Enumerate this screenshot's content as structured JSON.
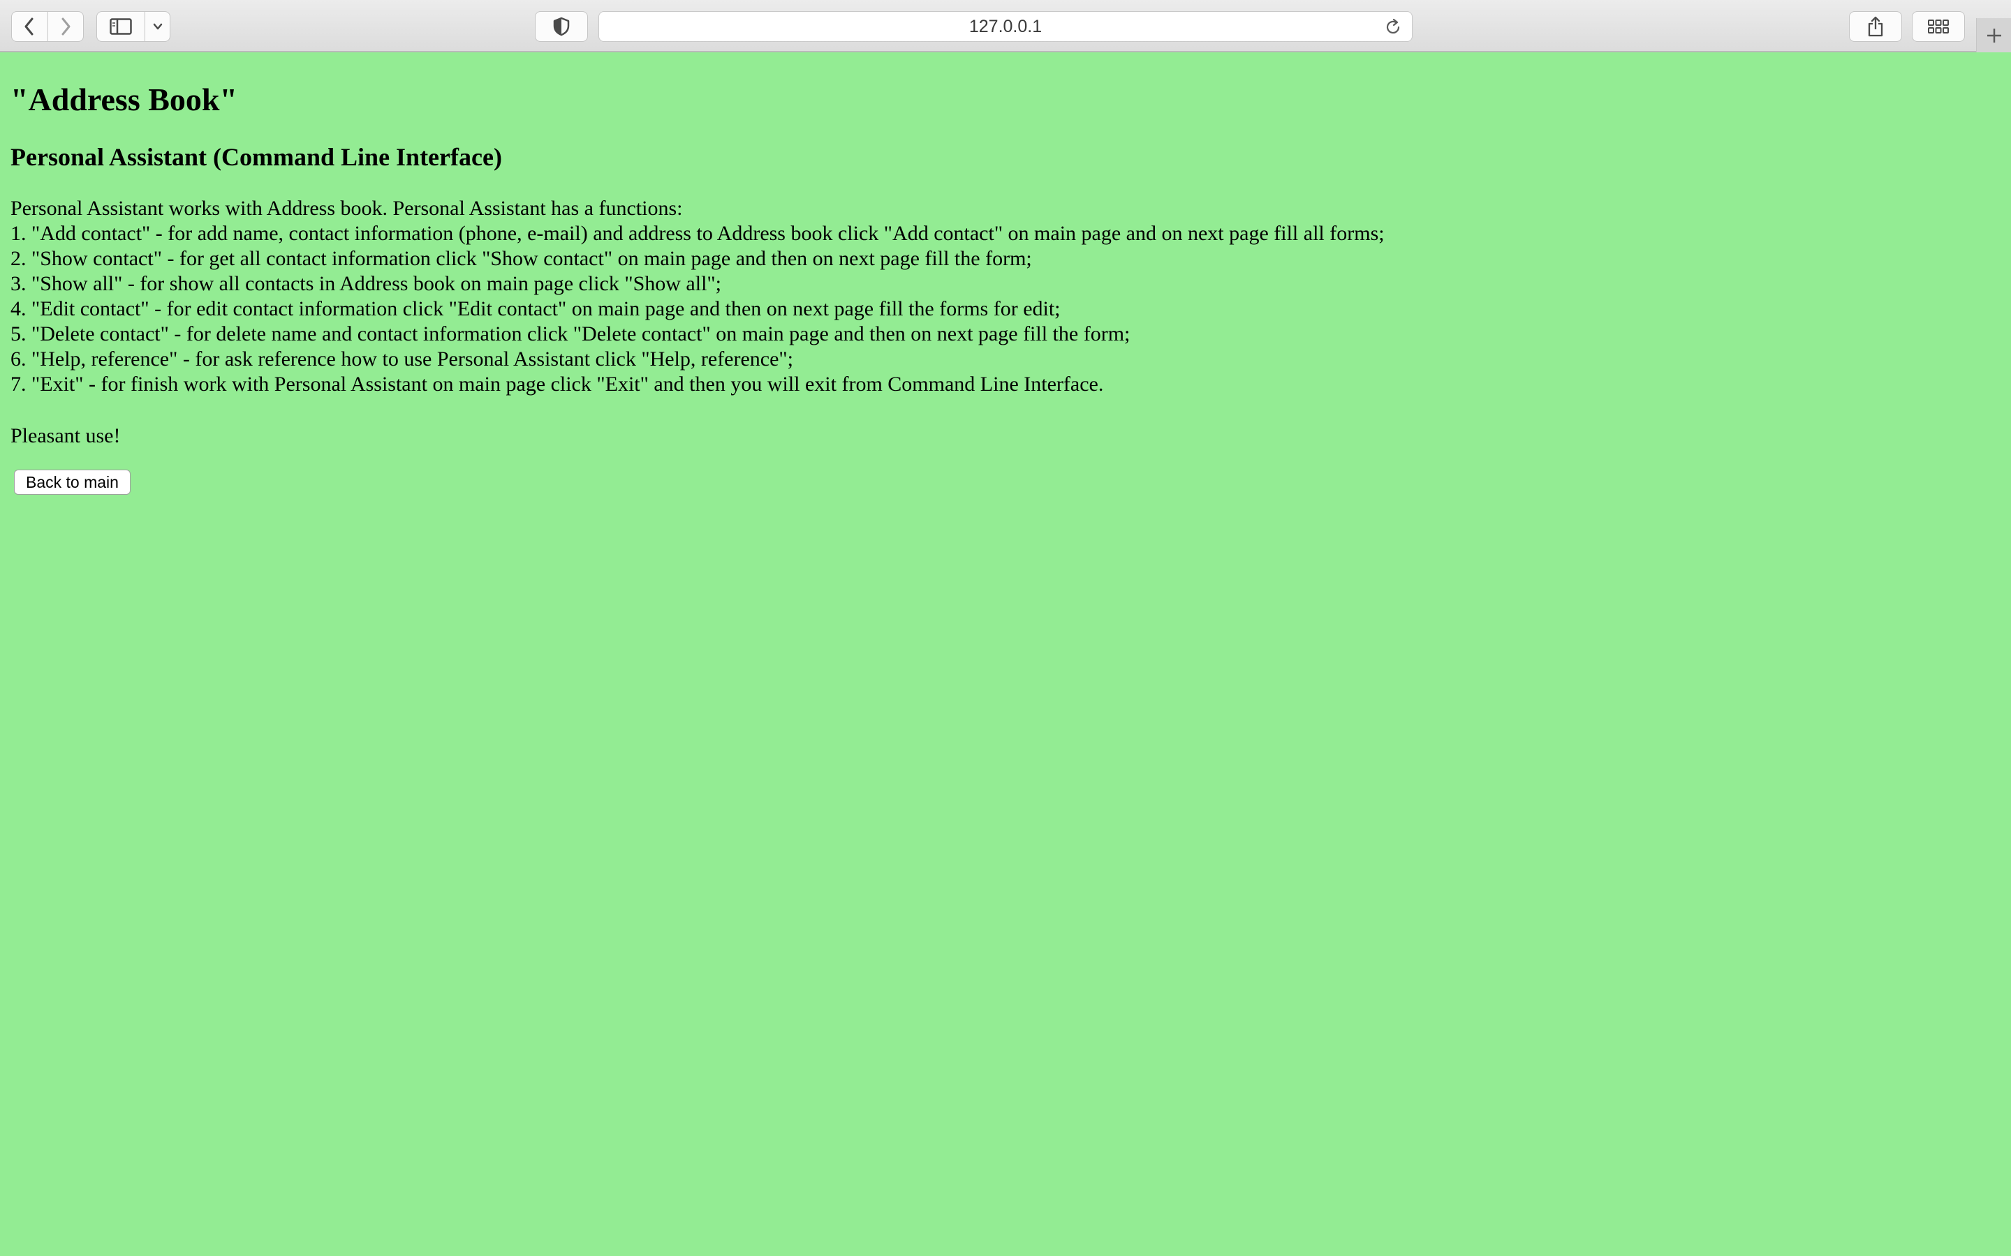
{
  "browser": {
    "url": "127.0.0.1",
    "icons": {
      "back": "chevron-left-icon",
      "forward": "chevron-right-icon",
      "sidebar": "sidebar-icon",
      "sidebar_menu": "chevron-down-icon",
      "privacy": "shield-icon",
      "reload": "reload-icon",
      "share": "share-icon",
      "tabs": "tab-overview-icon",
      "new_tab": "plus-icon"
    }
  },
  "page": {
    "background": "#93ec93",
    "title": "\"Address Book\"",
    "subtitle": "Personal Assistant (Command Line Interface)",
    "intro": "Personal Assistant works with Address book. Personal Assistant has a functions:",
    "functions": [
      "1. \"Add contact\" - for add name, contact information (phone, e-mail) and address to Address book click \"Add contact\" on main page and on next page fill all forms;",
      "2. \"Show contact\" - for get all contact information click \"Show contact\" on main page and then on next page fill the form;",
      "3. \"Show all\" - for show all contacts in Address book on main page click \"Show all\";",
      "4. \"Edit contact\" - for edit contact information click \"Edit contact\" on main page and then on next page fill the forms for edit;",
      "5. \"Delete contact\" - for delete name and contact information click \"Delete contact\" on main page and then on next page fill the form;",
      "6. \"Help, reference\" - for ask reference how to use Personal Assistant click \"Help, reference\";",
      "7. \"Exit\" - for finish work with Personal Assistant on main page click \"Exit\" and then you will exit from Command Line Interface."
    ],
    "closing": "Pleasant use!",
    "back_button_label": "Back to main"
  }
}
